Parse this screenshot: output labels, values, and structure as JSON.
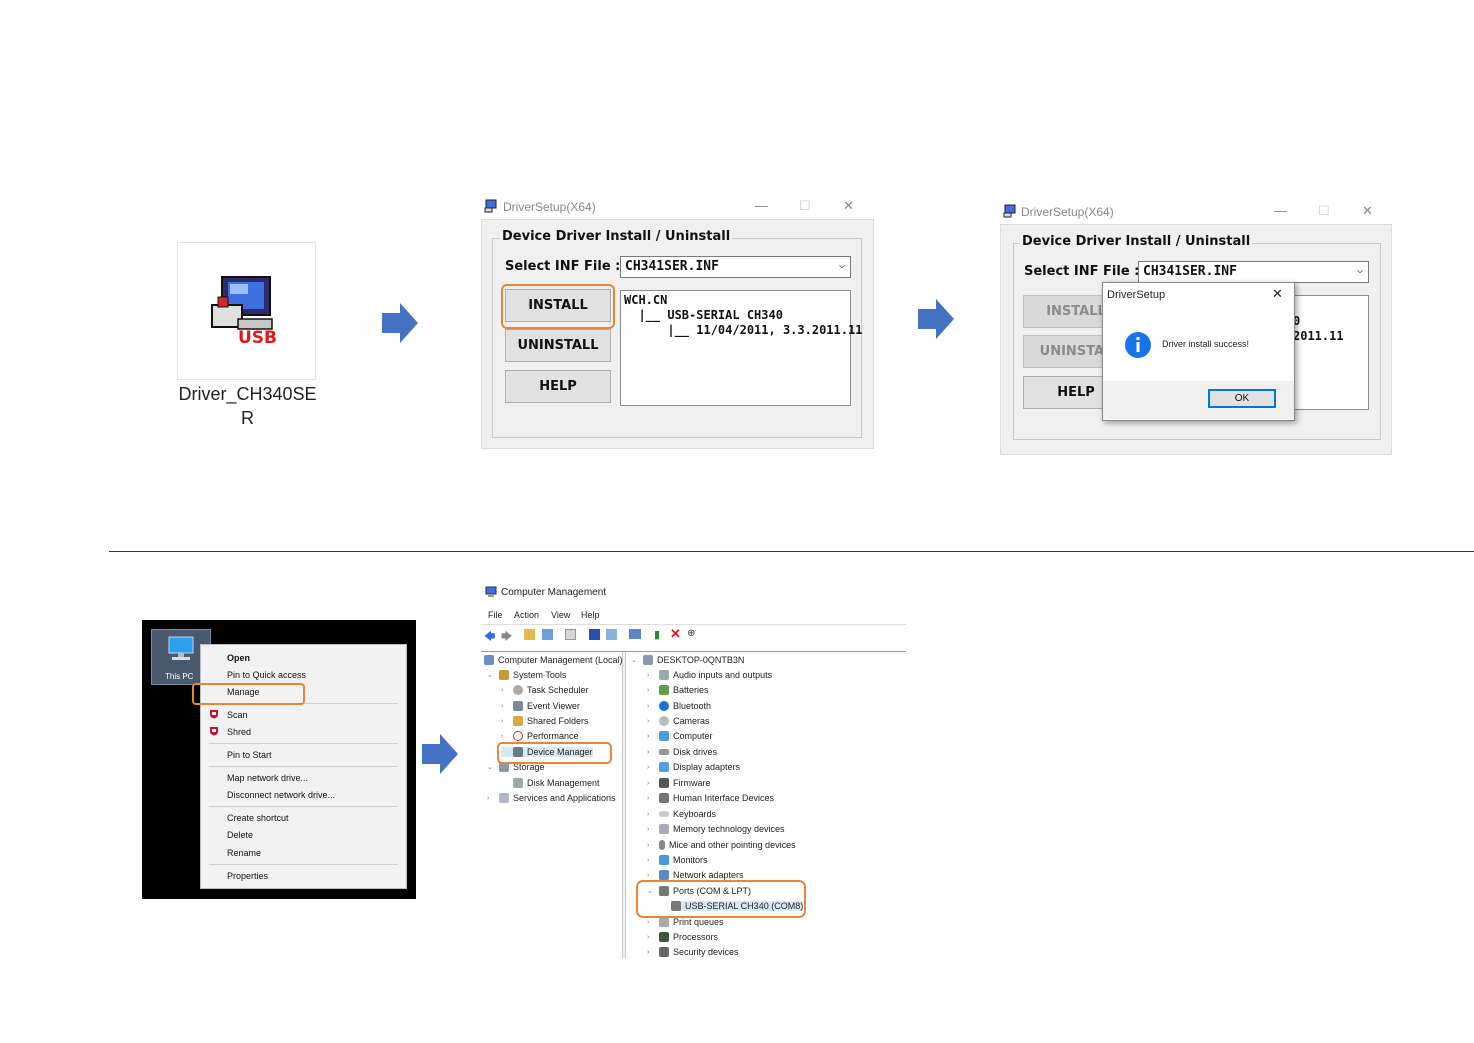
{
  "step1": {
    "file_name": "Driver_CH340SE R",
    "icon_label": "USB"
  },
  "setup_window_1": {
    "title": "DriverSetup(X64)",
    "group_title": "Device Driver Install / Uninstall",
    "select_inf_label": "Select INF File :",
    "inf_value": "CH341SER.INF",
    "install_label": "INSTALL",
    "uninstall_label": "UNINSTALL",
    "help_label": "HELP",
    "info_lines": [
      "WCH.CN",
      "  |__ USB-SERIAL CH340",
      "      |__ 11/04/2011, 3.3.2011.11"
    ]
  },
  "setup_window_2": {
    "title": "DriverSetup(X64)",
    "group_title": "Device Driver Install / Uninstall",
    "select_inf_label": "Select INF File :",
    "inf_value": "CH341SER.INF",
    "install_label": "INSTALL",
    "uninstall_label": "UNINSTAL",
    "help_label": "HELP",
    "info_partial_1": "0",
    "info_partial_2": "2011.11",
    "dialog": {
      "title": "DriverSetup",
      "message": "Driver install success!",
      "ok_label": "OK"
    }
  },
  "context_menu": {
    "desktop_icon_label": "This PC",
    "items": [
      "Open",
      "Pin to Quick access",
      "Manage",
      "Scan",
      "Shred",
      "Pin to Start",
      "Map network drive...",
      "Disconnect network drive...",
      "Create shortcut",
      "Delete",
      "Rename",
      "Properties"
    ]
  },
  "computer_management": {
    "title": "Computer Management",
    "menu": [
      "File",
      "Action",
      "View",
      "Help"
    ],
    "left_tree": [
      "Computer Management (Local)",
      "System Tools",
      "Task Scheduler",
      "Event Viewer",
      "Shared Folders",
      "Performance",
      "Device Manager",
      "Storage",
      "Disk Management",
      "Services and Applications"
    ],
    "computer_name": "DESKTOP-0QNTB3N",
    "device_categories": [
      "Audio inputs and outputs",
      "Batteries",
      "Bluetooth",
      "Cameras",
      "Computer",
      "Disk drives",
      "Display adapters",
      "Firmware",
      "Human Interface Devices",
      "Keyboards",
      "Memory technology devices",
      "Mice and other pointing devices",
      "Monitors",
      "Network adapters",
      "Ports (COM & LPT)",
      "USB-SERIAL CH340 (COM8)",
      "Print queues",
      "Processors",
      "Security devices"
    ]
  },
  "colors": {
    "arrow": "#4472c4",
    "highlight": "#e8853a",
    "info_icon": "#1a73e8"
  }
}
